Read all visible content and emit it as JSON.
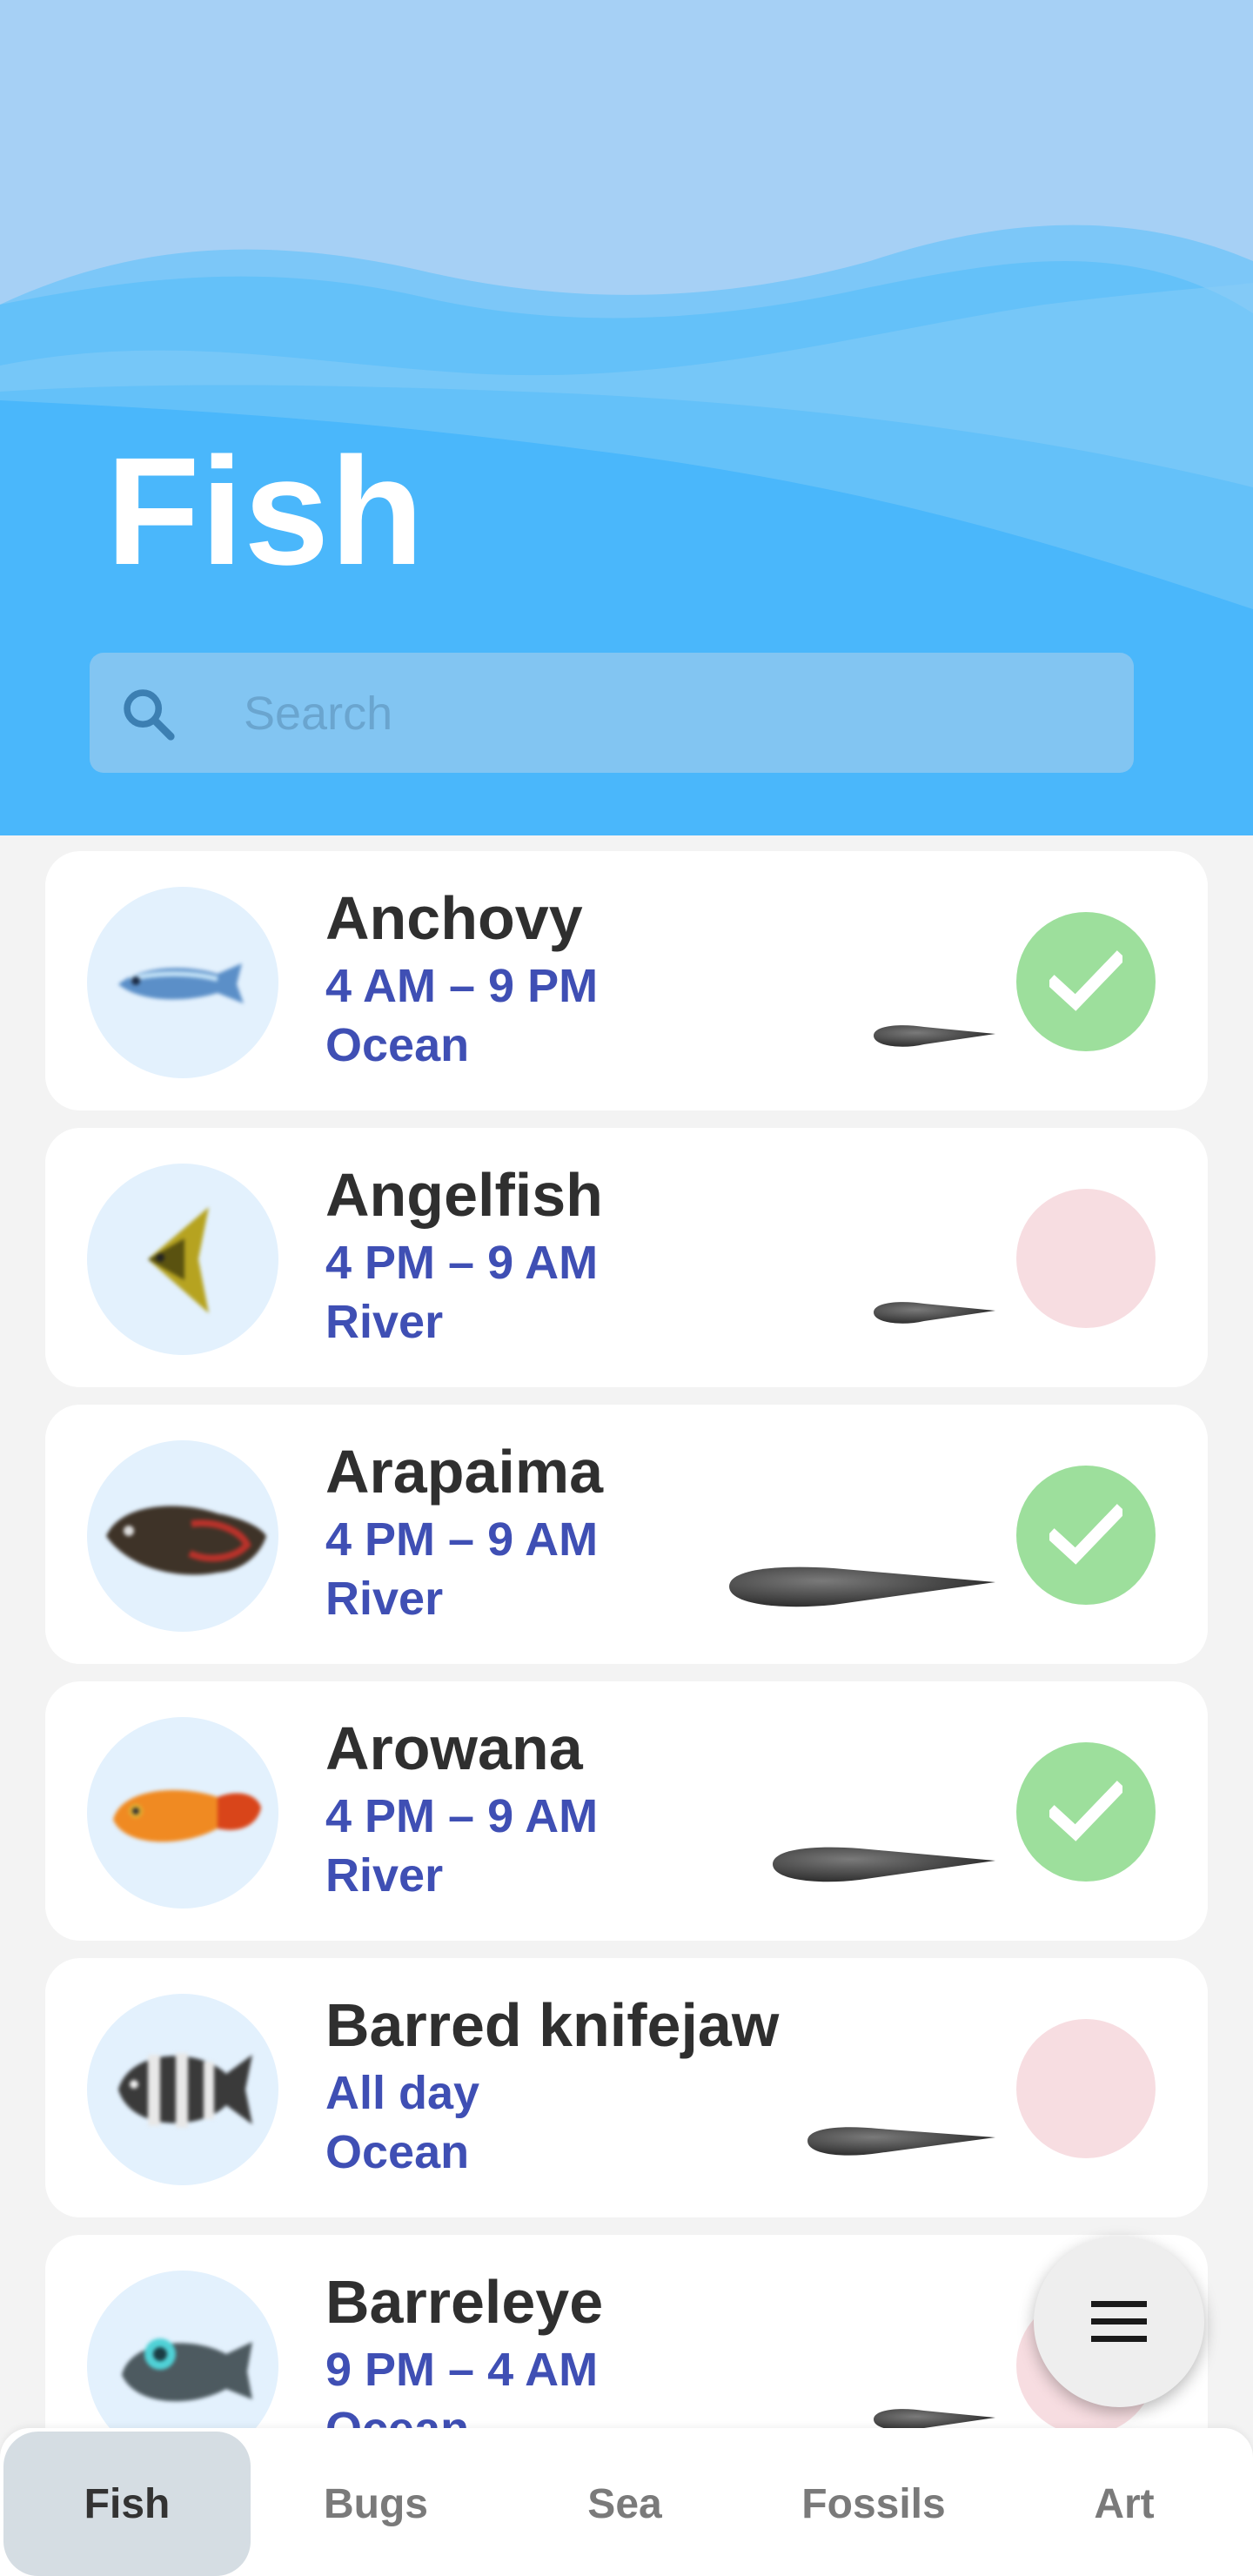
{
  "header": {
    "title": "Fish",
    "search_placeholder": "Search"
  },
  "items": [
    {
      "name": "Anchovy",
      "time": "4 AM – 9 PM",
      "location": "Ocean",
      "caught": true,
      "icon": "anchovy-icon",
      "shadow_size": "small"
    },
    {
      "name": "Angelfish",
      "time": "4 PM – 9 AM",
      "location": "River",
      "caught": false,
      "icon": "angelfish-icon",
      "shadow_size": "small"
    },
    {
      "name": "Arapaima",
      "time": "4 PM – 9 AM",
      "location": "River",
      "caught": true,
      "icon": "arapaima-icon",
      "shadow_size": "extra-large"
    },
    {
      "name": "Arowana",
      "time": "4 PM – 9 AM",
      "location": "River",
      "caught": true,
      "icon": "arowana-icon",
      "shadow_size": "large"
    },
    {
      "name": "Barred knifejaw",
      "time": "All day",
      "location": "Ocean",
      "caught": false,
      "icon": "barred-knifejaw-icon",
      "shadow_size": "medium"
    },
    {
      "name": "Barreleye",
      "time": "9 PM – 4 AM",
      "location": "Ocean",
      "caught": false,
      "icon": "barreleye-icon",
      "shadow_size": "small"
    }
  ],
  "fab": {
    "icon": "menu-icon"
  },
  "nav": {
    "tabs": [
      "Fish",
      "Bugs",
      "Sea",
      "Fossils",
      "Art"
    ],
    "active": "Fish"
  },
  "colors": {
    "header_blue": "#4ab7fb",
    "caught_green": "#9ddf9c",
    "uncaught_pink": "#f7dde1",
    "detail_text": "#3f4fb4"
  }
}
